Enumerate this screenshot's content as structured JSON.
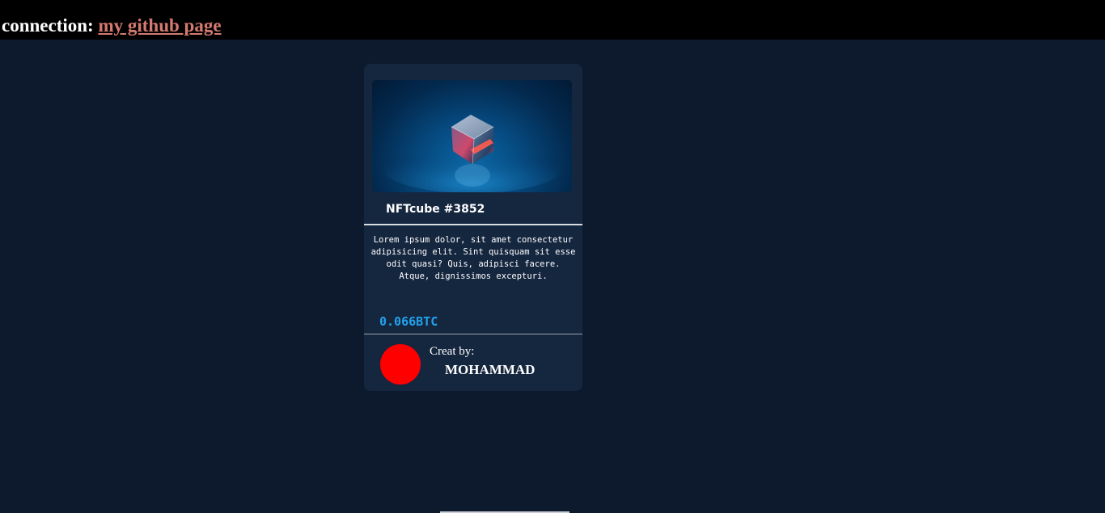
{
  "header": {
    "label": "connection:",
    "link_text": "my github page"
  },
  "card": {
    "image_alt": "glowing glass cube",
    "title": "NFTcube #3852",
    "description": "Lorem ipsum dolor, sit amet consectetur adipisicing elit. Sint quisquam sit esse odit quasi? Quis, adipisci facere. Atque, dignissimos excepturi.",
    "price": "0.066BTC",
    "creator_label": "Creat by:",
    "creator_name": "MOHAMMAD"
  },
  "colors": {
    "page_background": "#0d1a2e",
    "header_background": "#000000",
    "card_background": "#15263f",
    "link": "#d67a70",
    "price": "#21a3ee",
    "avatar": "#ff0000"
  }
}
